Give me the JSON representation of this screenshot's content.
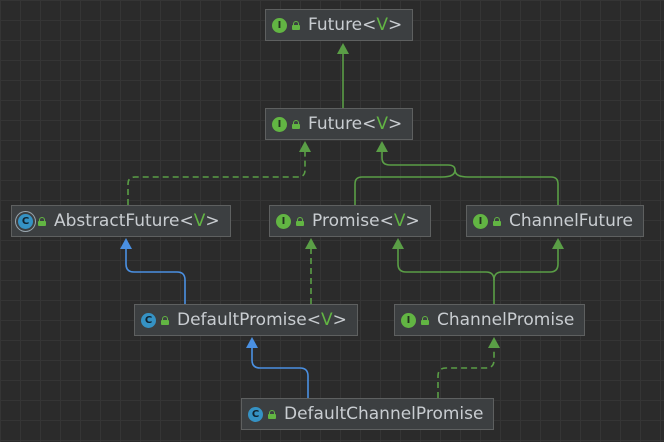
{
  "nodes": {
    "future_top": {
      "name": "Future",
      "generic": "V",
      "kind": "interface",
      "icon": "interface-icon",
      "badge": "I"
    },
    "future_mid": {
      "name": "Future",
      "generic": "V",
      "kind": "interface",
      "icon": "interface-icon",
      "badge": "I"
    },
    "abstract_future": {
      "name": "AbstractFuture",
      "generic": "V",
      "kind": "abstract-class",
      "icon": "abstract-class-icon",
      "badge": "C"
    },
    "promise": {
      "name": "Promise",
      "generic": "V",
      "kind": "interface",
      "icon": "interface-icon",
      "badge": "I"
    },
    "channel_future": {
      "name": "ChannelFuture",
      "generic": "",
      "kind": "interface",
      "icon": "interface-icon",
      "badge": "I"
    },
    "default_promise": {
      "name": "DefaultPromise",
      "generic": "V",
      "kind": "class",
      "icon": "class-icon",
      "badge": "C"
    },
    "channel_promise": {
      "name": "ChannelPromise",
      "generic": "",
      "kind": "interface",
      "icon": "interface-icon",
      "badge": "I"
    },
    "default_channel_promise": {
      "name": "DefaultChannelPromise",
      "generic": "",
      "kind": "class",
      "icon": "class-icon",
      "badge": "C"
    }
  },
  "edges": [
    {
      "from": "future_mid",
      "to": "future_top",
      "type": "extends"
    },
    {
      "from": "abstract_future",
      "to": "future_mid",
      "type": "implements"
    },
    {
      "from": "promise",
      "to": "future_mid",
      "type": "extends"
    },
    {
      "from": "channel_future",
      "to": "future_mid",
      "type": "extends"
    },
    {
      "from": "default_promise",
      "to": "abstract_future",
      "type": "class-extends"
    },
    {
      "from": "default_promise",
      "to": "promise",
      "type": "implements"
    },
    {
      "from": "channel_promise",
      "to": "promise",
      "type": "extends"
    },
    {
      "from": "channel_promise",
      "to": "channel_future",
      "type": "extends"
    },
    {
      "from": "default_channel_promise",
      "to": "default_promise",
      "type": "class-extends"
    },
    {
      "from": "default_channel_promise",
      "to": "channel_promise",
      "type": "implements"
    }
  ],
  "colors": {
    "background": "#2b2b2b",
    "node_fill": "#3c3f41",
    "node_border": "#5e6060",
    "text": "#c9cdd1",
    "interface_green": "#62b543",
    "class_blue": "#3592c4",
    "extends_line": "#5a9e46",
    "class_extends_line": "#4a90e2"
  }
}
